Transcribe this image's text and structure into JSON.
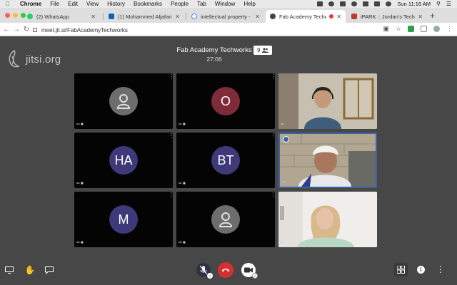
{
  "menubar": {
    "app": "Chrome",
    "items": [
      "File",
      "Edit",
      "View",
      "History",
      "Bookmarks",
      "People",
      "Tab",
      "Window",
      "Help"
    ],
    "clock": "Sun 11:16 AM"
  },
  "tabs": [
    {
      "label": "(2) WhatsApp",
      "color": "#25d366"
    },
    {
      "label": "(1) Mohammed Aljafari | Link",
      "color": "#0a66c2"
    },
    {
      "label": "intellectual property - Goog",
      "color": "#4285f4"
    },
    {
      "label": "Fab Academy Techworks",
      "color": "#444444"
    },
    {
      "label": "iPARK :: Jordan's Technolog",
      "color": "#c0392b"
    }
  ],
  "address": {
    "url": "meet.jit.si/FabAcademyTechworks"
  },
  "meeting": {
    "logo_text": "jitsi.org",
    "title": "Fab Academy Techworks",
    "participant_count": "9",
    "timer": "27:06"
  },
  "tiles": [
    {
      "initials": "",
      "avatar": "person-icon"
    },
    {
      "initials": "O"
    },
    {
      "video": "man-headphones"
    },
    {
      "initials": "HA"
    },
    {
      "initials": "BT"
    },
    {
      "video": "man-white-cap"
    },
    {
      "initials": "M"
    },
    {
      "initials": "",
      "avatar": "person-icon"
    },
    {
      "video": "woman-blonde"
    }
  ],
  "colors": {
    "background": "#474747",
    "tile": "#040404",
    "active_border": "#3a63a8",
    "hangup": "#d62f2f"
  }
}
